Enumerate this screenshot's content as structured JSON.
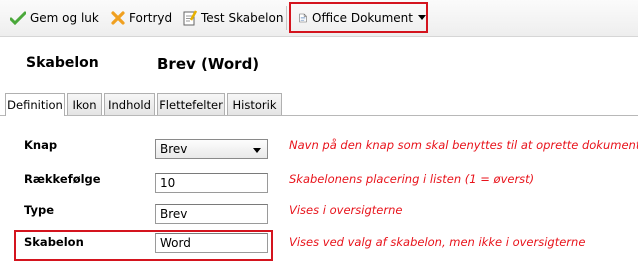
{
  "toolbar": {
    "save_close_label": "Gem og luk",
    "cancel_label": "Fortryd",
    "test_label": "Test Skabelon",
    "office_label": "Office Dokument"
  },
  "header": {
    "label": "Skabelon",
    "value": "Brev (Word)"
  },
  "tabs": [
    {
      "label": "Definition",
      "active": true
    },
    {
      "label": "Ikon"
    },
    {
      "label": "Indhold"
    },
    {
      "label": "Flettefelter"
    },
    {
      "label": "Historik"
    }
  ],
  "form": {
    "knap": {
      "label": "Knap",
      "value": "Brev",
      "help": "Navn på den knap som skal benyttes til at oprette dokumentet"
    },
    "raekkefolge": {
      "label": "Rækkefølge",
      "value": "10",
      "help": "Skabelonens placering i listen (1 = øverst)"
    },
    "type": {
      "label": "Type",
      "value": "Brev",
      "help": "Vises i oversigterne"
    },
    "skabelon": {
      "label": "Skabelon",
      "value": "Word",
      "help": "Vises ved valg af skabelon, men ikke i oversigterne"
    }
  },
  "colors": {
    "highlight": "#d4141e",
    "help_text": "#e8131b"
  }
}
